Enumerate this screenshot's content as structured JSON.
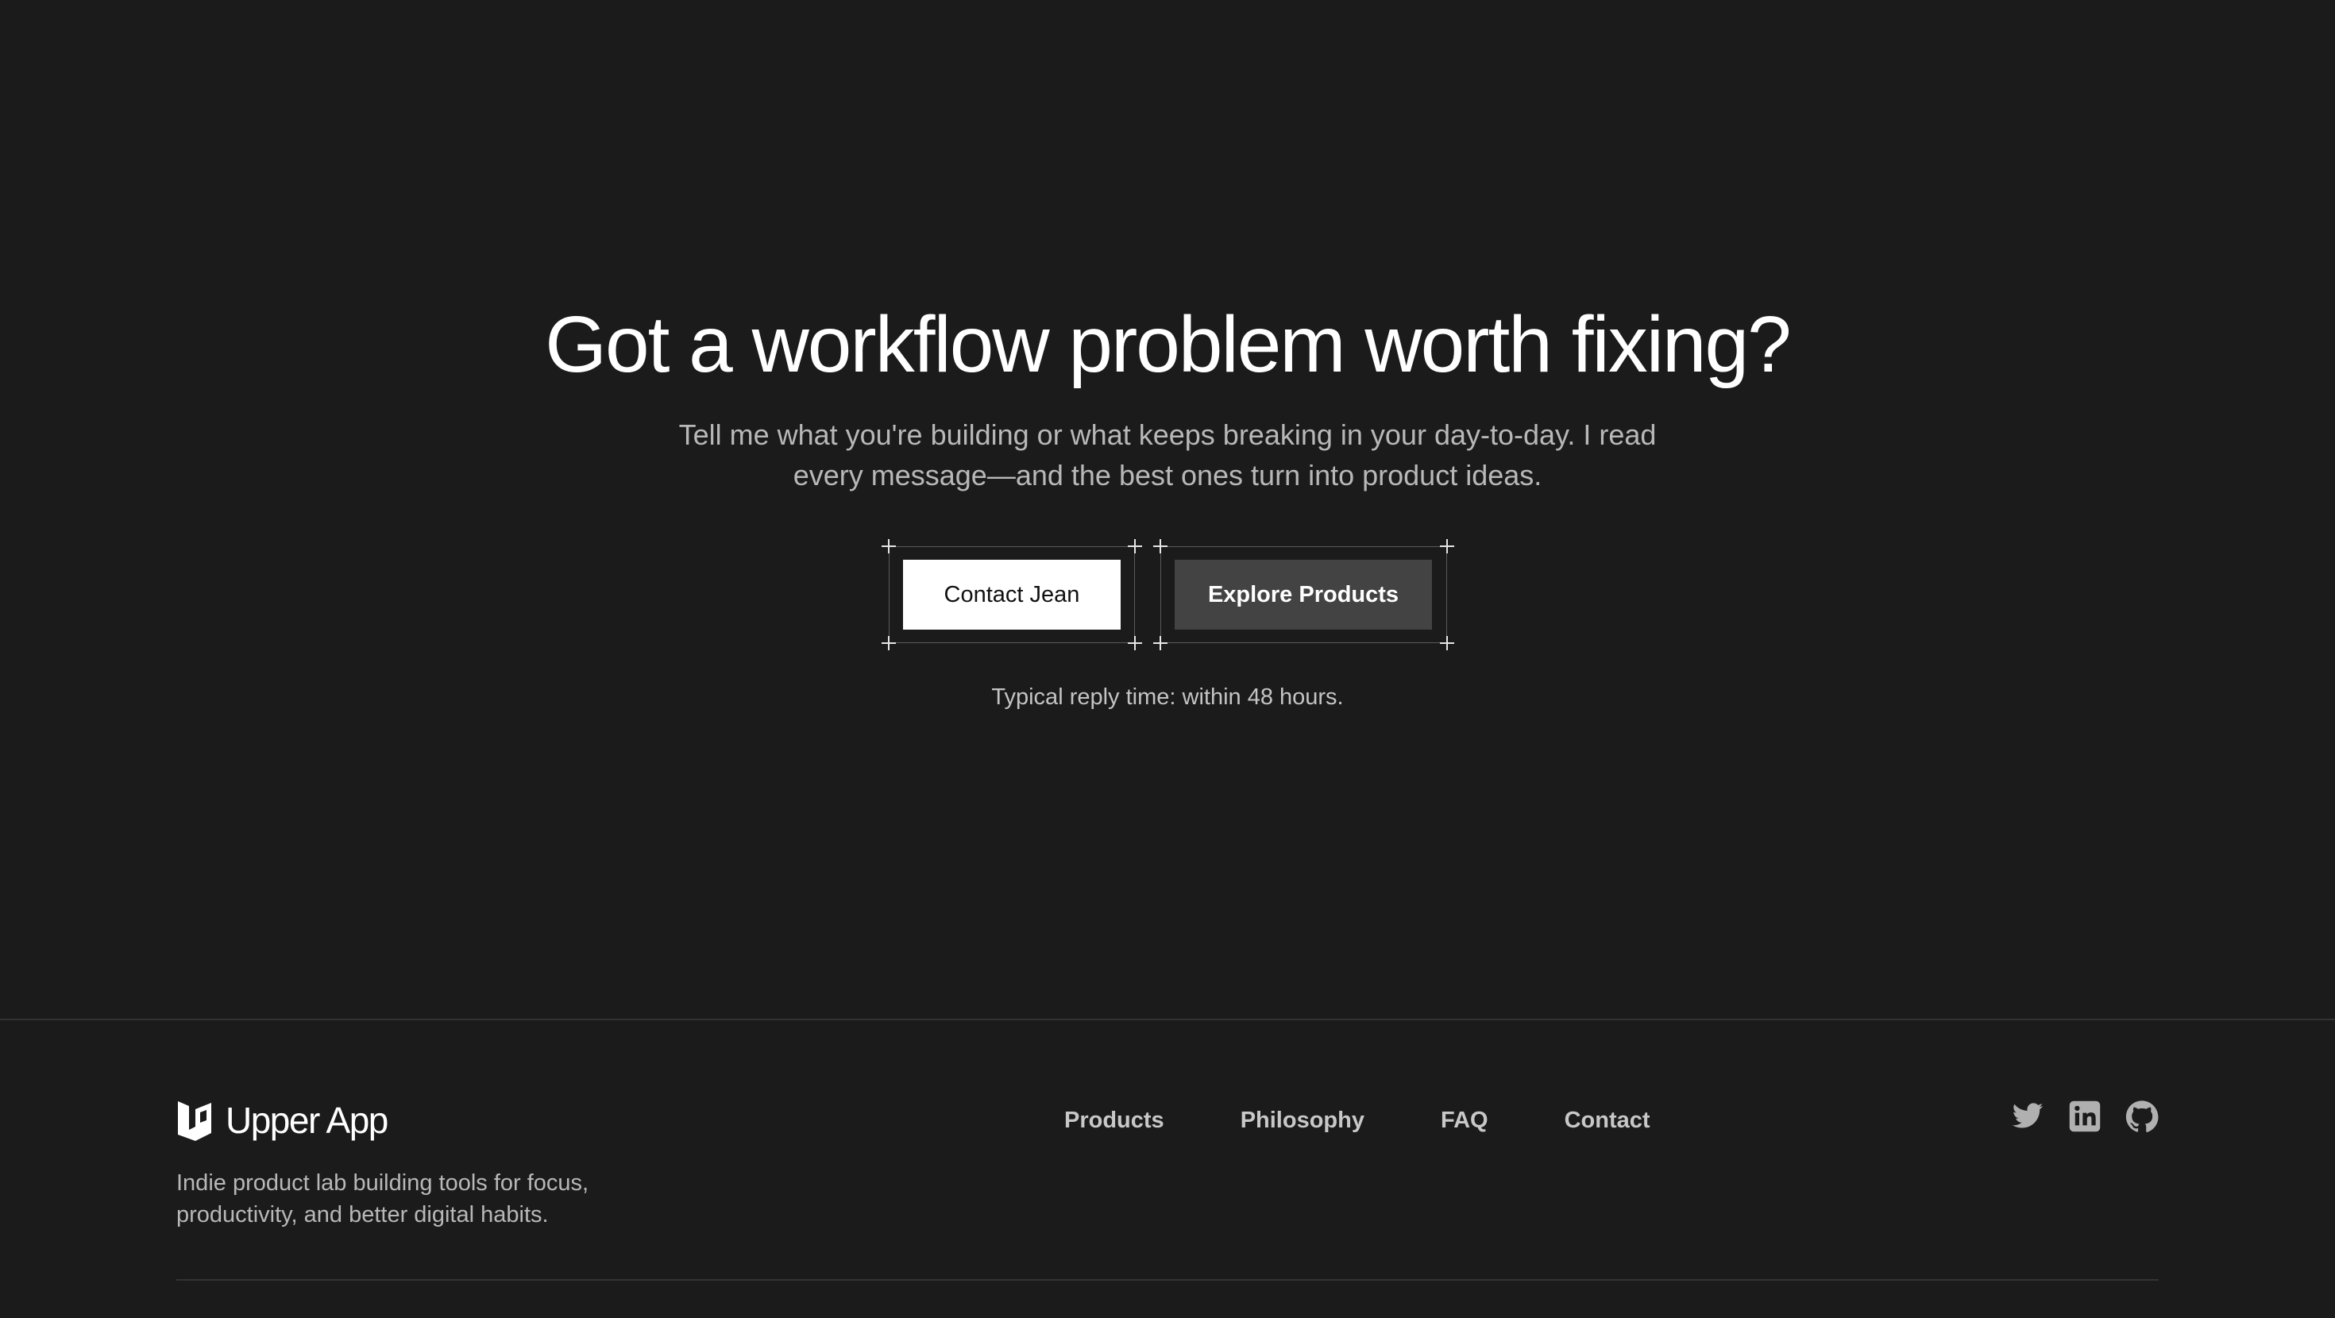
{
  "hero": {
    "headline": "Got a workflow problem worth fixing?",
    "subcopy": "Tell me what you're building or what keeps breaking in your day-to-day. I read every message—and the best ones turn into product ideas.",
    "primary_cta": "Contact Jean",
    "secondary_cta": "Explore Products",
    "reply_note": "Typical reply time: within 48 hours."
  },
  "footer": {
    "brand_name": "Upper App",
    "tagline": "Indie product lab building tools for focus, productivity, and better digital habits.",
    "nav": [
      {
        "label": "Products"
      },
      {
        "label": "Philosophy"
      },
      {
        "label": "FAQ"
      },
      {
        "label": "Contact"
      }
    ],
    "socials": [
      {
        "icon": "twitter-icon"
      },
      {
        "icon": "linkedin-icon"
      },
      {
        "icon": "github-icon"
      }
    ]
  },
  "colors": {
    "background": "#1b1b1b",
    "text_primary": "#ffffff",
    "text_muted": "#b8b8b8",
    "button_secondary": "#434343",
    "icon": "#b0b0b0"
  }
}
